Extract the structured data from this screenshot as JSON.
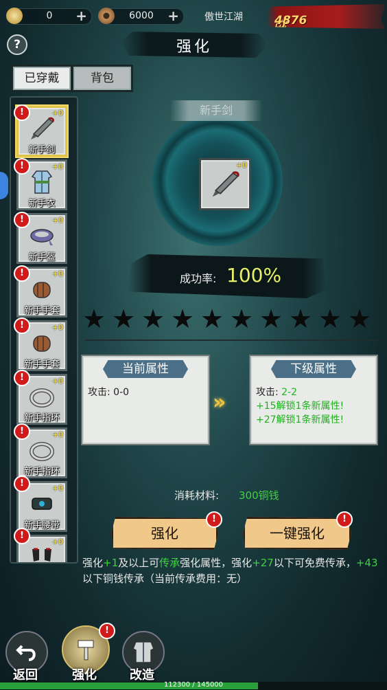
{
  "topbar": {
    "ingot": "0",
    "coin": "6000",
    "server": "傲世江湖",
    "power_label": "战力:",
    "power_value": "4876"
  },
  "title": "强化",
  "help_icon": "?",
  "tabs": {
    "equipped": "已穿戴",
    "bag": "背包"
  },
  "equipment": [
    {
      "name": "新手剑",
      "level": "+0",
      "icon": "sword-icon",
      "selected": true
    },
    {
      "name": "新手衣",
      "level": "+0",
      "icon": "robe-icon"
    },
    {
      "name": "新手盔",
      "level": "+0",
      "icon": "headband-icon"
    },
    {
      "name": "新手手套",
      "level": "+0",
      "icon": "glove-icon"
    },
    {
      "name": "新手手套",
      "level": "+0",
      "icon": "glove-icon"
    },
    {
      "name": "新手指环",
      "level": "+0",
      "icon": "ring-icon"
    },
    {
      "name": "新手指环",
      "level": "+0",
      "icon": "ring-icon"
    },
    {
      "name": "新手腰带",
      "level": "+0",
      "icon": "belt-icon"
    },
    {
      "name": "",
      "level": "+0",
      "icon": "boots-icon"
    }
  ],
  "selected_item": {
    "name": "新手剑",
    "level": "+0"
  },
  "success": {
    "label": "成功率:",
    "value": "100%"
  },
  "stars": {
    "total": 10,
    "filled": 0
  },
  "current_attr": {
    "title": "当前属性",
    "line1": "攻击: 0-0"
  },
  "next_attr": {
    "title": "下级属性",
    "attack_label": "攻击: ",
    "attack_value": "2-2",
    "unlock1": "+15解锁1条新属性!",
    "unlock2": "+27解锁1条新属性!"
  },
  "cost": {
    "label": "消耗材料:",
    "value": "300铜钱"
  },
  "buttons": {
    "enhance": "强化",
    "one_key": "一键强化"
  },
  "note": {
    "p1": "强化",
    "p2": "+1",
    "p3": "及以上可",
    "p4": "传承",
    "p5": "强化属性，强化",
    "p6": "+27",
    "p7": "以下可免费传承，",
    "p8": "+43",
    "p9": "以下铜钱传承（当前传承费用：无）"
  },
  "nav": {
    "back": "返回",
    "enhance": "强化",
    "forge": "改造"
  },
  "xp": {
    "text": "112300 / 145000",
    "current": 112300,
    "max": 145000
  },
  "colors": {
    "accent": "#e7f06a",
    "green": "#3fd23f",
    "alert": "#d11a1a"
  }
}
